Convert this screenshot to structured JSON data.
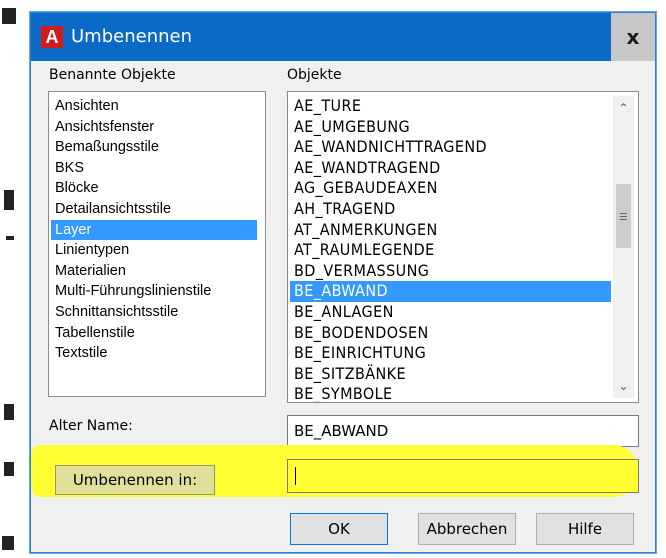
{
  "dialog": {
    "title": "Umbenennen",
    "app_icon_letter": "A",
    "close_glyph": "x"
  },
  "named_objects": {
    "label": "Benannte Objekte",
    "items": [
      "Ansichten",
      "Ansichtsfenster",
      "Bemaßungsstile",
      "BKS",
      "Blöcke",
      "Detailansichtsstile",
      "Layer",
      "Linientypen",
      "Materialien",
      "Multi-Führungslinienstile",
      "Schnittansichtsstile",
      "Tabellenstile",
      "Textstile"
    ],
    "selected": "Layer"
  },
  "objects": {
    "label": "Objekte",
    "items": [
      "AE_TURE",
      "AE_UMGEBUNG",
      "AE_WANDNICHTTRAGEND",
      "AE_WANDTRAGEND",
      "AG_GEBAUDEAXEN",
      "AH_TRAGEND",
      "AT_ANMERKUNGEN",
      "AT_RAUMLEGENDE",
      "BD_VERMASSUNG",
      "BE_ABWAND",
      "BE_ANLAGEN",
      "BE_BODENDOSEN",
      "BE_EINRICHTUNG",
      "BE_SITZBÄNKE",
      "BE_SYMBOLE"
    ],
    "selected": "BE_ABWAND"
  },
  "old_name": {
    "label": "Alter Name:",
    "value": "BE_ABWAND"
  },
  "rename_to": {
    "button_label": "Umbenennen in:",
    "value": ""
  },
  "buttons": {
    "ok": "OK",
    "cancel": "Abbrechen",
    "help": "Hilfe"
  },
  "colors": {
    "titlebar": "#0b6ac5",
    "selection": "#3399ff",
    "highlight": "#ffff33"
  }
}
